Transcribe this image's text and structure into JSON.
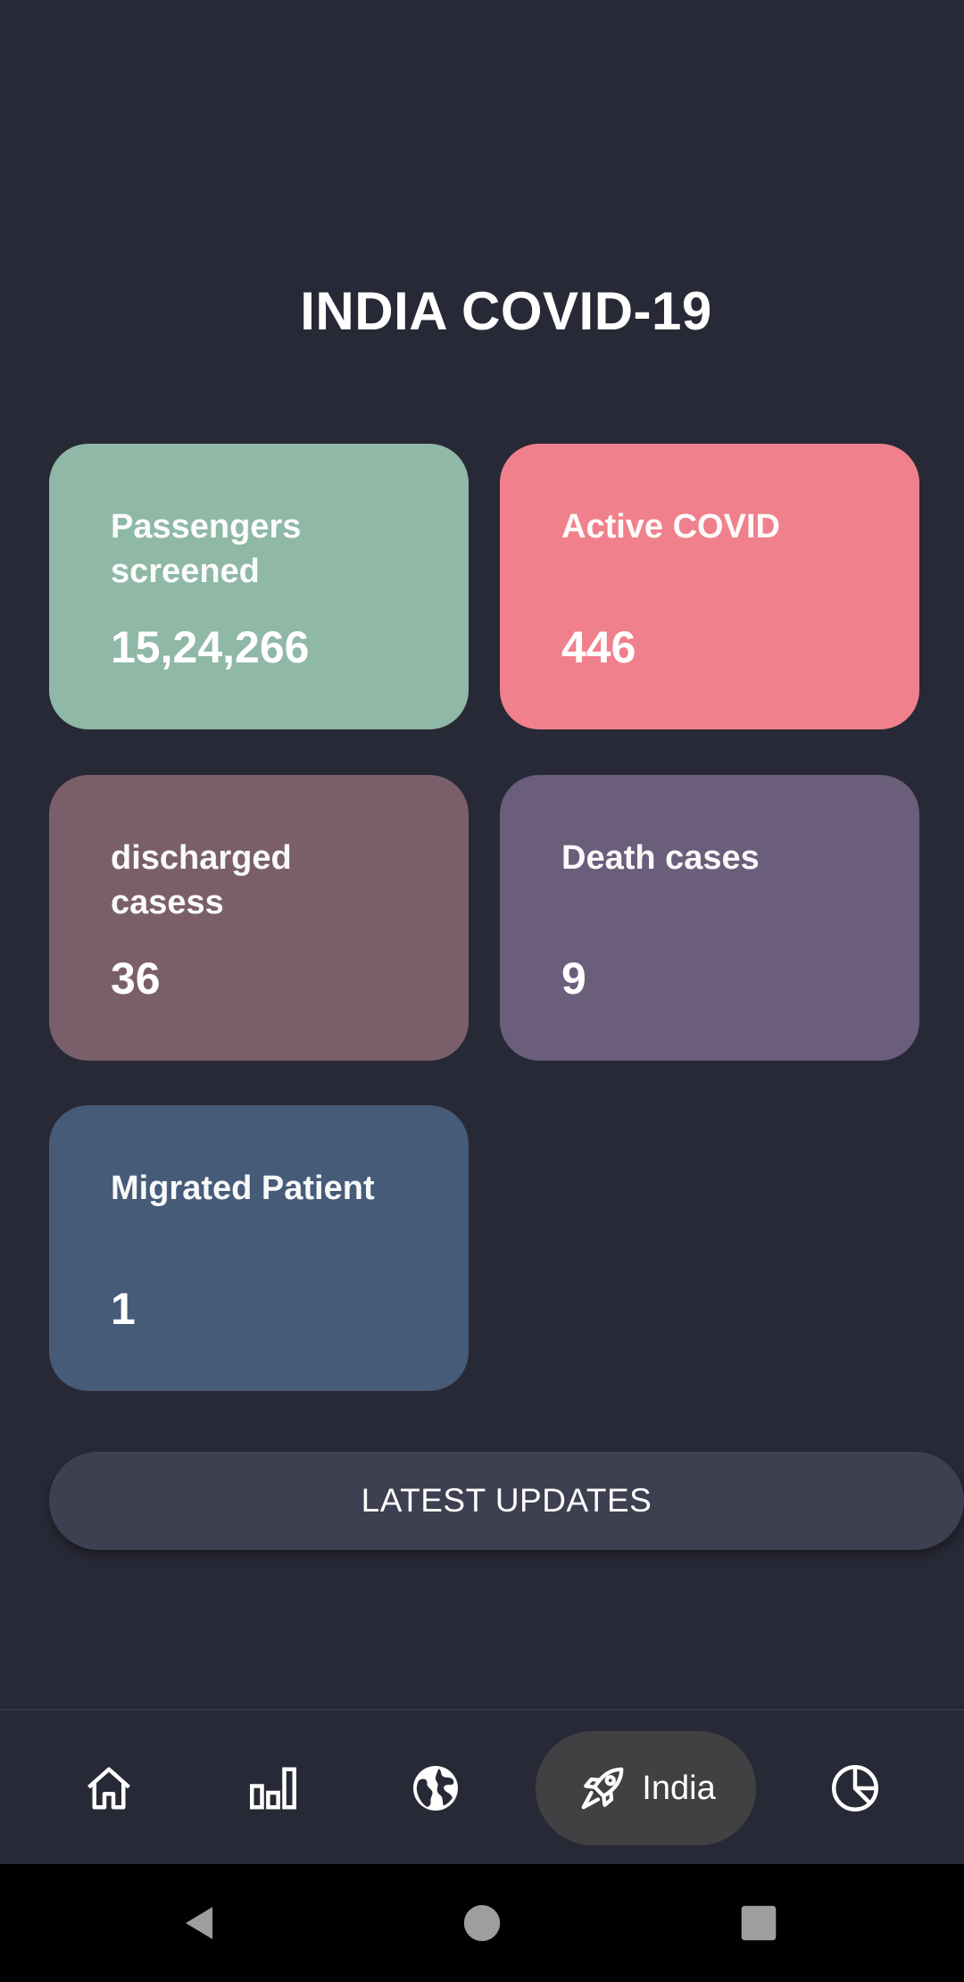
{
  "header": {
    "title": "INDIA COVID-19"
  },
  "stats": [
    {
      "label": "Passengers screened",
      "value": "15,24,266",
      "color": "#8fb8a6"
    },
    {
      "label": "Active COVID",
      "value": "446",
      "color": "#f0818c"
    },
    {
      "label": "discharged casess",
      "value": "36",
      "color": "#7a5f6a"
    },
    {
      "label": "Death cases",
      "value": "9",
      "color": "#6a5e7b"
    },
    {
      "label": "Migrated Patient",
      "value": "1",
      "color": "#465b78"
    }
  ],
  "actions": {
    "latest_updates_label": "LATEST UPDATES"
  },
  "bottom_nav": {
    "items": [
      {
        "icon": "home-icon",
        "label": ""
      },
      {
        "icon": "bar-chart-icon",
        "label": ""
      },
      {
        "icon": "globe-icon",
        "label": ""
      },
      {
        "icon": "rocket-icon",
        "label": "India",
        "selected": true
      },
      {
        "icon": "pie-chart-icon",
        "label": ""
      }
    ]
  },
  "system_nav": {
    "icons": [
      "back-icon",
      "home-circle-icon",
      "recents-icon"
    ]
  },
  "colors": {
    "background": "#282936",
    "button": "#3e3f50",
    "nav_selected": "#414143"
  }
}
